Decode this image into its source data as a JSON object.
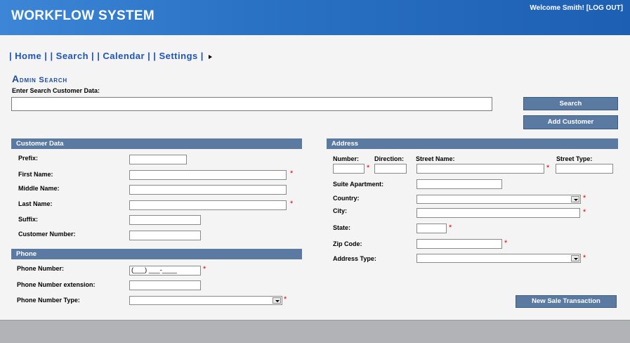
{
  "header": {
    "title": "WORKFLOW SYSTEM",
    "welcome": "Welcome Smith!",
    "logout": "[LOG OUT]"
  },
  "nav": {
    "items": [
      "Home",
      "Search",
      "Calendar",
      "Settings"
    ]
  },
  "admin_search": {
    "title": "Admin Search",
    "label": "Enter Search Customer Data:",
    "value": "",
    "search_button": "Search",
    "add_button": "Add Customer"
  },
  "customer": {
    "section": "Customer Data",
    "prefix": "Prefix:",
    "first_name": "First Name:",
    "middle_name": "Middle Name:",
    "last_name": "Last Name:",
    "suffix": "Suffix:",
    "customer_number": "Customer Number:"
  },
  "phone": {
    "section": "Phone",
    "number_label": "Phone Number:",
    "number_value": "(___) ___-____",
    "extension_label": "Phone Number extension:",
    "type_label": "Phone Number Type:"
  },
  "address": {
    "section": "Address",
    "number": "Number:",
    "direction": "Direction:",
    "street_name": "Street Name:",
    "street_type": "Street Type:",
    "suite": "Suite Apartment:",
    "country": "Country:",
    "city": "City:",
    "state": "State:",
    "zip": "Zip Code:",
    "address_type": "Address Type:"
  },
  "required_mark": "*",
  "actions": {
    "new_sale": "New Sale Transaction"
  },
  "colors": {
    "header": "#2a72c4",
    "accent": "#5b7aa1",
    "nav": "#1e54b8",
    "required": "#e00000",
    "footer": "#b2b3b6"
  }
}
